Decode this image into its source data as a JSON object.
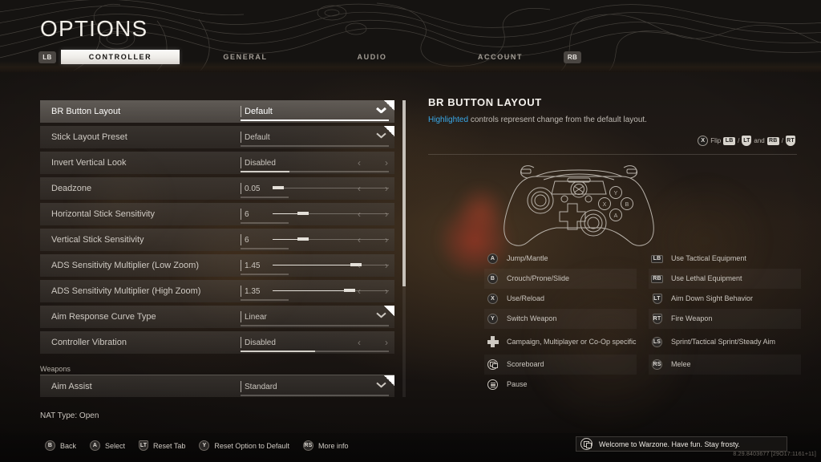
{
  "header": {
    "title": "OPTIONS",
    "bumper_left": "LB",
    "bumper_right": "RB",
    "tabs": [
      {
        "label": "CONTROLLER",
        "active": true
      },
      {
        "label": "GENERAL",
        "active": false
      },
      {
        "label": "AUDIO",
        "active": false
      },
      {
        "label": "ACCOUNT",
        "active": false
      }
    ]
  },
  "settings": {
    "rows": [
      {
        "label": "BR Button Layout",
        "value": "Default",
        "type": "dropdown",
        "selected": true,
        "ubar_fill": 100
      },
      {
        "label": "Stick Layout Preset",
        "value": "Default",
        "type": "dropdown",
        "selected": false,
        "ubar_fill": 0
      },
      {
        "label": "Invert Vertical Look",
        "value": "Disabled",
        "type": "stepper",
        "selected": false,
        "ubar_fill": 33
      },
      {
        "label": "Deadzone",
        "value": "0.05",
        "type": "slider",
        "selected": false,
        "slider_pct": 5
      },
      {
        "label": "Horizontal Stick Sensitivity",
        "value": "6",
        "type": "slider",
        "selected": false,
        "slider_pct": 26
      },
      {
        "label": "Vertical Stick Sensitivity",
        "value": "6",
        "type": "slider",
        "selected": false,
        "slider_pct": 26
      },
      {
        "label": "ADS Sensitivity Multiplier (Low Zoom)",
        "value": "1.45",
        "type": "slider",
        "selected": false,
        "slider_pct": 72
      },
      {
        "label": "ADS Sensitivity Multiplier (High Zoom)",
        "value": "1.35",
        "type": "slider",
        "selected": false,
        "slider_pct": 66
      },
      {
        "label": "Aim Response Curve Type",
        "value": "Linear",
        "type": "dropdown",
        "selected": false,
        "ubar_fill": 0
      },
      {
        "label": "Controller Vibration",
        "value": "Disabled",
        "type": "stepper",
        "selected": false,
        "ubar_fill": 50
      }
    ],
    "section_header": "Weapons",
    "trailing_row": {
      "label": "Aim Assist",
      "value": "Standard",
      "type": "dropdown"
    }
  },
  "detail": {
    "title": "BR BUTTON LAYOUT",
    "desc_highlight": "Highlighted",
    "desc_rest": " controls represent change from the default layout.",
    "flip_hint": {
      "button": "X",
      "label": "Flip",
      "sep1": "/",
      "and": "and",
      "sep2": "/",
      "lb": "LB",
      "lt": "LT",
      "rb": "RB",
      "rt": "RT"
    },
    "bindings_left": [
      {
        "glyph": "A",
        "glyph_type": "round",
        "text": "Jump/Mantle"
      },
      {
        "glyph": "B",
        "glyph_type": "round",
        "text": "Crouch/Prone/Slide"
      },
      {
        "glyph": "X",
        "glyph_type": "round",
        "text": "Use/Reload"
      },
      {
        "glyph": "Y",
        "glyph_type": "round",
        "text": "Switch Weapon"
      },
      {
        "glyph": "dpad",
        "glyph_type": "dpad",
        "text": "Campaign, Multiplayer or Co-Op specific"
      },
      {
        "glyph": "view",
        "glyph_type": "view",
        "text": "Scoreboard"
      },
      {
        "glyph": "menu",
        "glyph_type": "menu",
        "text": "Pause"
      }
    ],
    "bindings_right": [
      {
        "glyph": "LB",
        "glyph_type": "rect",
        "text": "Use Tactical Equipment"
      },
      {
        "glyph": "RB",
        "glyph_type": "rect",
        "text": "Use Lethal Equipment"
      },
      {
        "glyph": "LT",
        "glyph_type": "trig",
        "text": "Aim Down Sight Behavior"
      },
      {
        "glyph": "RT",
        "glyph_type": "trig",
        "text": "Fire Weapon"
      },
      {
        "glyph": "LS",
        "glyph_type": "round",
        "text": "Sprint/Tactical Sprint/Steady Aim"
      },
      {
        "glyph": "RS",
        "glyph_type": "round",
        "text": "Melee"
      }
    ]
  },
  "footer": {
    "nat_type": "NAT Type: Open",
    "actions": [
      {
        "glyph": "B",
        "glyph_type": "round",
        "label": "Back"
      },
      {
        "glyph": "A",
        "glyph_type": "round",
        "label": "Select"
      },
      {
        "glyph": "LT",
        "glyph_type": "trig",
        "label": "Reset Tab"
      },
      {
        "glyph": "Y",
        "glyph_type": "round",
        "label": "Reset Option to Default"
      },
      {
        "glyph": "RS",
        "glyph_type": "round",
        "label": "More info"
      }
    ]
  },
  "toast": {
    "message": "Welcome to Warzone. Have fun. Stay frosty."
  },
  "build": "8.29.8403677 [29O17:1161+11]",
  "colors": {
    "accent_blue": "#39a8e8",
    "highlight_white": "#ffffff",
    "row_bg": "#4e4944",
    "text_primary": "#e9e6e1",
    "text_muted": "#bfbab3"
  }
}
